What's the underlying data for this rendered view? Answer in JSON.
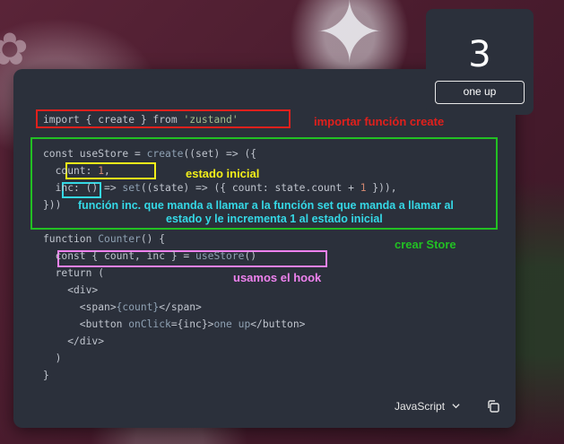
{
  "counter": {
    "count": "3",
    "button_label": "one up"
  },
  "code": {
    "l1": "import { create } from 'zustand'",
    "l2": "const useStore = create((set) => ({",
    "l3": "  count: 1,",
    "l4": "  inc: () => set((state) => ({ count: state.count + 1 })),",
    "l5": "}))",
    "l6": "function Counter() {",
    "l7": "  const { count, inc } = useStore()",
    "l8": "  return (",
    "l9": "    <div>",
    "l10": "      <span>{count}</span>",
    "l11": "      <button onClick={inc}>one up</button>",
    "l12": "    </div>",
    "l13": "  )",
    "l14": "}"
  },
  "annotations": {
    "import": "importar función create",
    "initial_state": "estado inicial",
    "inc_line1": "función inc. que manda a llamar a la función set que manda a llamar al",
    "inc_line2": "estado y le incrementa 1 al estado inicial",
    "create_store": "crear Store",
    "hook": "usamos el hook"
  },
  "toolbar": {
    "language": "JavaScript",
    "copy_icon": "copy-icon",
    "chevron_icon": "chevron-down-icon"
  },
  "colors": {
    "red": "#e0201c",
    "green": "#22c023",
    "yellow": "#f2ee1a",
    "cyan": "#35d8e6",
    "pink": "#ee82ee",
    "card": "#2b303b"
  }
}
